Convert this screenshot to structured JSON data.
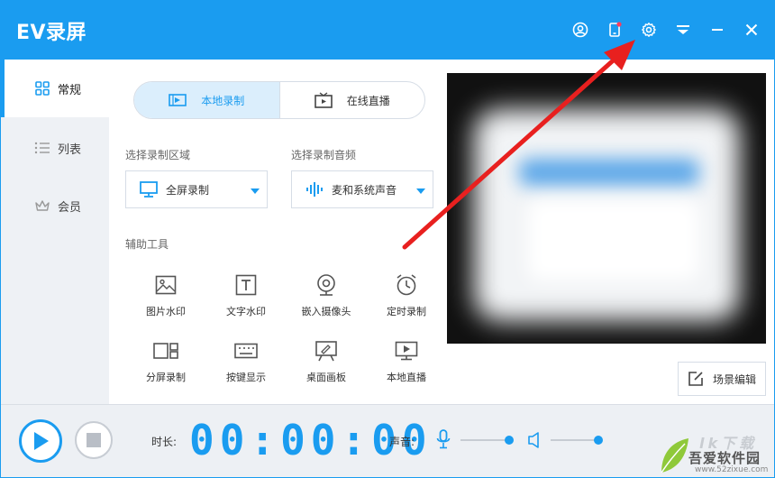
{
  "app": {
    "title": "EV录屏"
  },
  "titlebar_icons": [
    "user-icon",
    "phone-icon",
    "gear-icon",
    "dropdown-icon",
    "minimize-icon",
    "close-icon"
  ],
  "sidebar": {
    "items": [
      {
        "label": "常规",
        "icon": "grid-icon",
        "active": true
      },
      {
        "label": "列表",
        "icon": "list-icon",
        "active": false
      },
      {
        "label": "会员",
        "icon": "crown-icon",
        "active": false
      }
    ]
  },
  "mode_tabs": [
    {
      "label": "本地录制",
      "icon": "record-icon",
      "active": true
    },
    {
      "label": "在线直播",
      "icon": "tv-icon",
      "active": false
    }
  ],
  "region": {
    "label": "选择录制区域",
    "value": "全屏录制",
    "icon": "monitor-icon"
  },
  "audio": {
    "label": "选择录制音频",
    "value": "麦和系统声音",
    "icon": "waveform-icon"
  },
  "tools": {
    "label": "辅助工具",
    "items": [
      {
        "label": "图片水印",
        "icon": "image-icon"
      },
      {
        "label": "文字水印",
        "icon": "text-icon"
      },
      {
        "label": "嵌入摄像头",
        "icon": "webcam-icon"
      },
      {
        "label": "定时录制",
        "icon": "alarm-clock-icon"
      },
      {
        "label": "分屏录制",
        "icon": "split-screen-icon"
      },
      {
        "label": "按键显示",
        "icon": "keyboard-icon"
      },
      {
        "label": "桌面画板",
        "icon": "easel-icon"
      },
      {
        "label": "本地直播",
        "icon": "play-screen-icon"
      }
    ]
  },
  "scene_button": {
    "label": "场景编辑",
    "icon": "edit-icon"
  },
  "bottom": {
    "duration_label": "时长:",
    "timer": "00:00:00",
    "volume_label": "声音:",
    "mic_level": 1.0,
    "speaker_level": 1.0
  },
  "watermark": {
    "big": "lk下载",
    "cn": "吾爱软件园",
    "url": "www.52zixue.com"
  },
  "colors": {
    "accent": "#1a9cf0",
    "annotation_arrow": "#e8201f"
  }
}
